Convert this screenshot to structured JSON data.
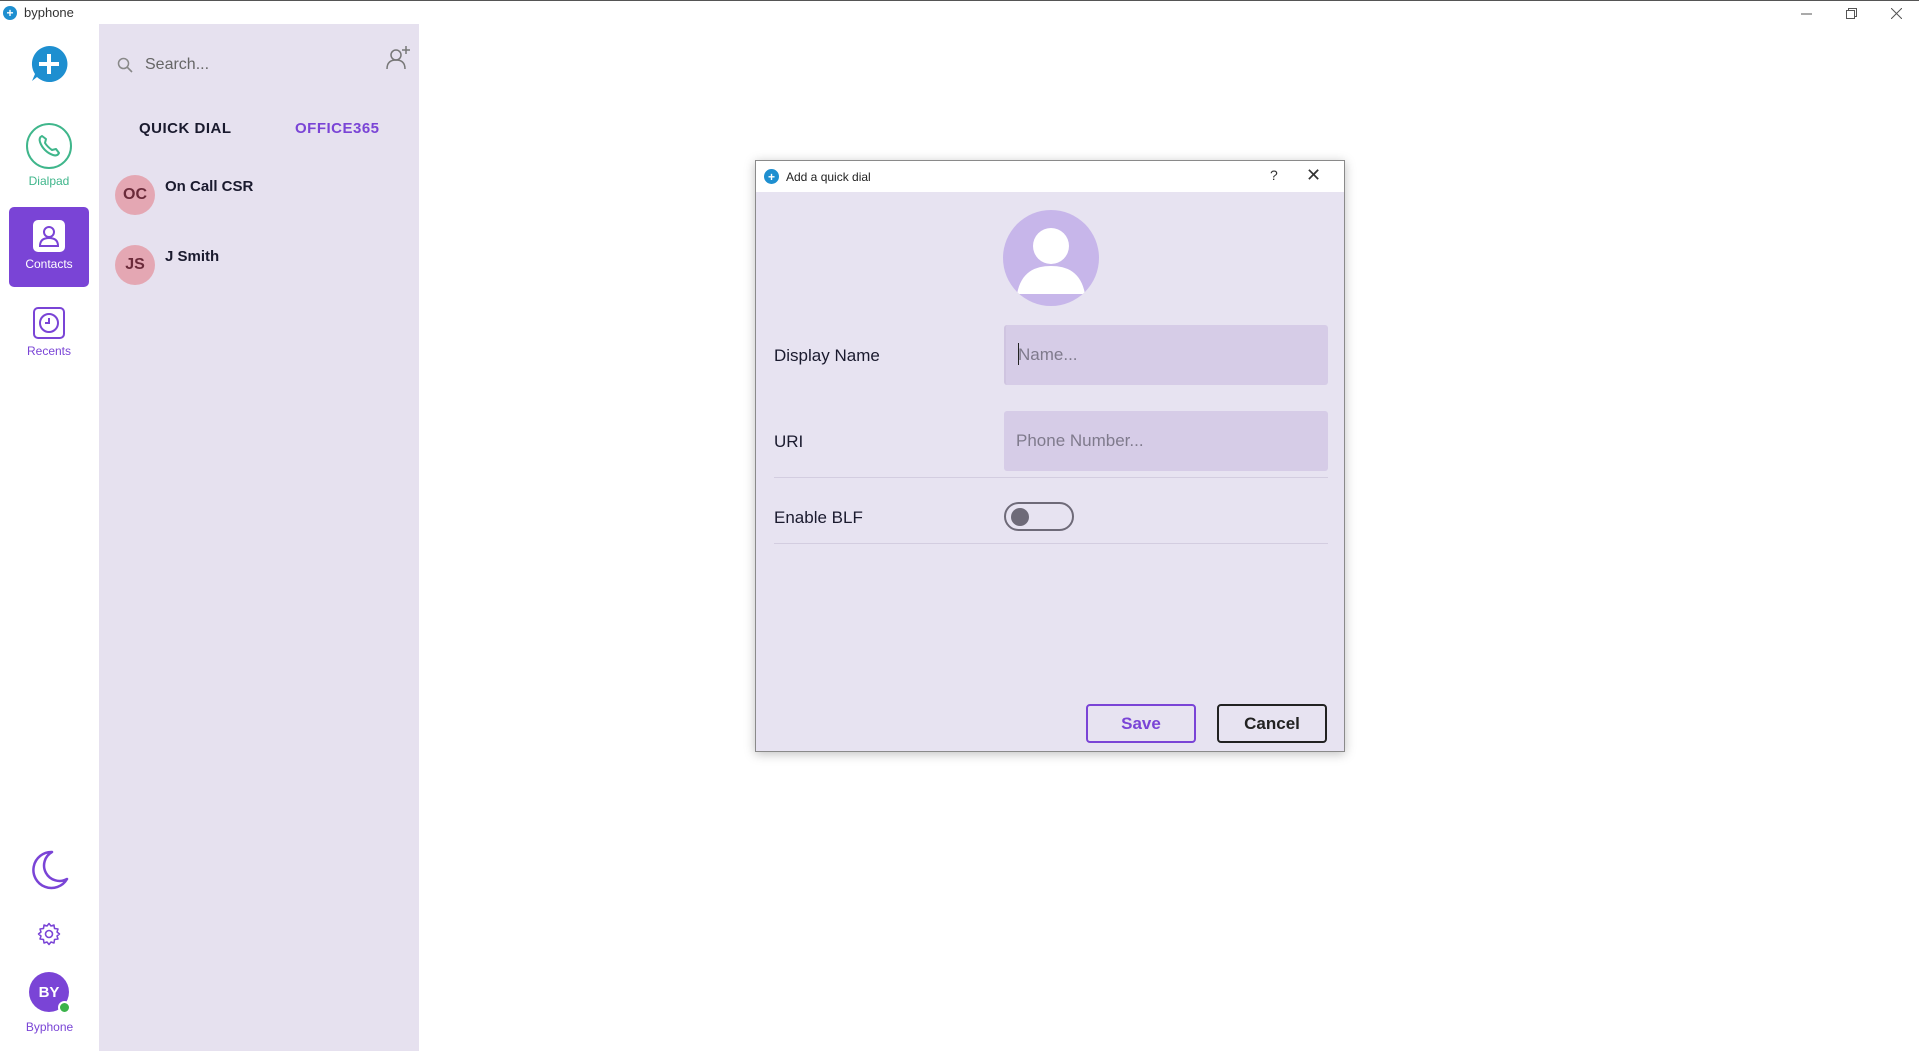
{
  "window": {
    "title": "byphone",
    "app_icon": "plus-icon",
    "controls": [
      "minimize-icon",
      "restore-icon",
      "close-icon"
    ]
  },
  "rail": {
    "new_button_icon": "plus-chat-icon",
    "items": [
      {
        "label": "Dialpad",
        "icon": "phone-icon",
        "color": "#3fb68b",
        "active": false
      },
      {
        "label": "Contacts",
        "icon": "person-icon",
        "color": "#ffffff",
        "active": true
      },
      {
        "label": "Recents",
        "icon": "clock-icon",
        "color": "#7a44d6",
        "active": false
      }
    ],
    "theme_icon": "moon-icon",
    "settings_icon": "gear-icon",
    "user": {
      "initials": "BY",
      "label": "Byphone",
      "status": "online"
    }
  },
  "panel": {
    "search_placeholder": "Search...",
    "add_contact_icon": "add-person-icon",
    "tabs": [
      {
        "label": "QUICK DIAL",
        "active": true
      },
      {
        "label": "OFFICE365",
        "active": false
      }
    ],
    "contacts": [
      {
        "initials": "OC",
        "name": "On Call CSR"
      },
      {
        "initials": "JS",
        "name": "J Smith"
      }
    ]
  },
  "dialog": {
    "title": "Add a quick dial",
    "help_label": "?",
    "close_label": "✕",
    "fields": {
      "display_name": {
        "label": "Display Name",
        "placeholder": "Name...",
        "value": ""
      },
      "uri": {
        "label": "URI",
        "placeholder": "Phone Number...",
        "value": ""
      },
      "blf": {
        "label": "Enable BLF",
        "enabled": false
      }
    },
    "save_label": "Save",
    "cancel_label": "Cancel"
  },
  "colors": {
    "accent": "#7a44d6",
    "panel_bg": "#e6e1ef",
    "dialog_bg": "#e7e3f1",
    "dialpad_green": "#3fb68b",
    "presence_green": "#3bb34a",
    "initials_bg": "#e4a7b3"
  }
}
